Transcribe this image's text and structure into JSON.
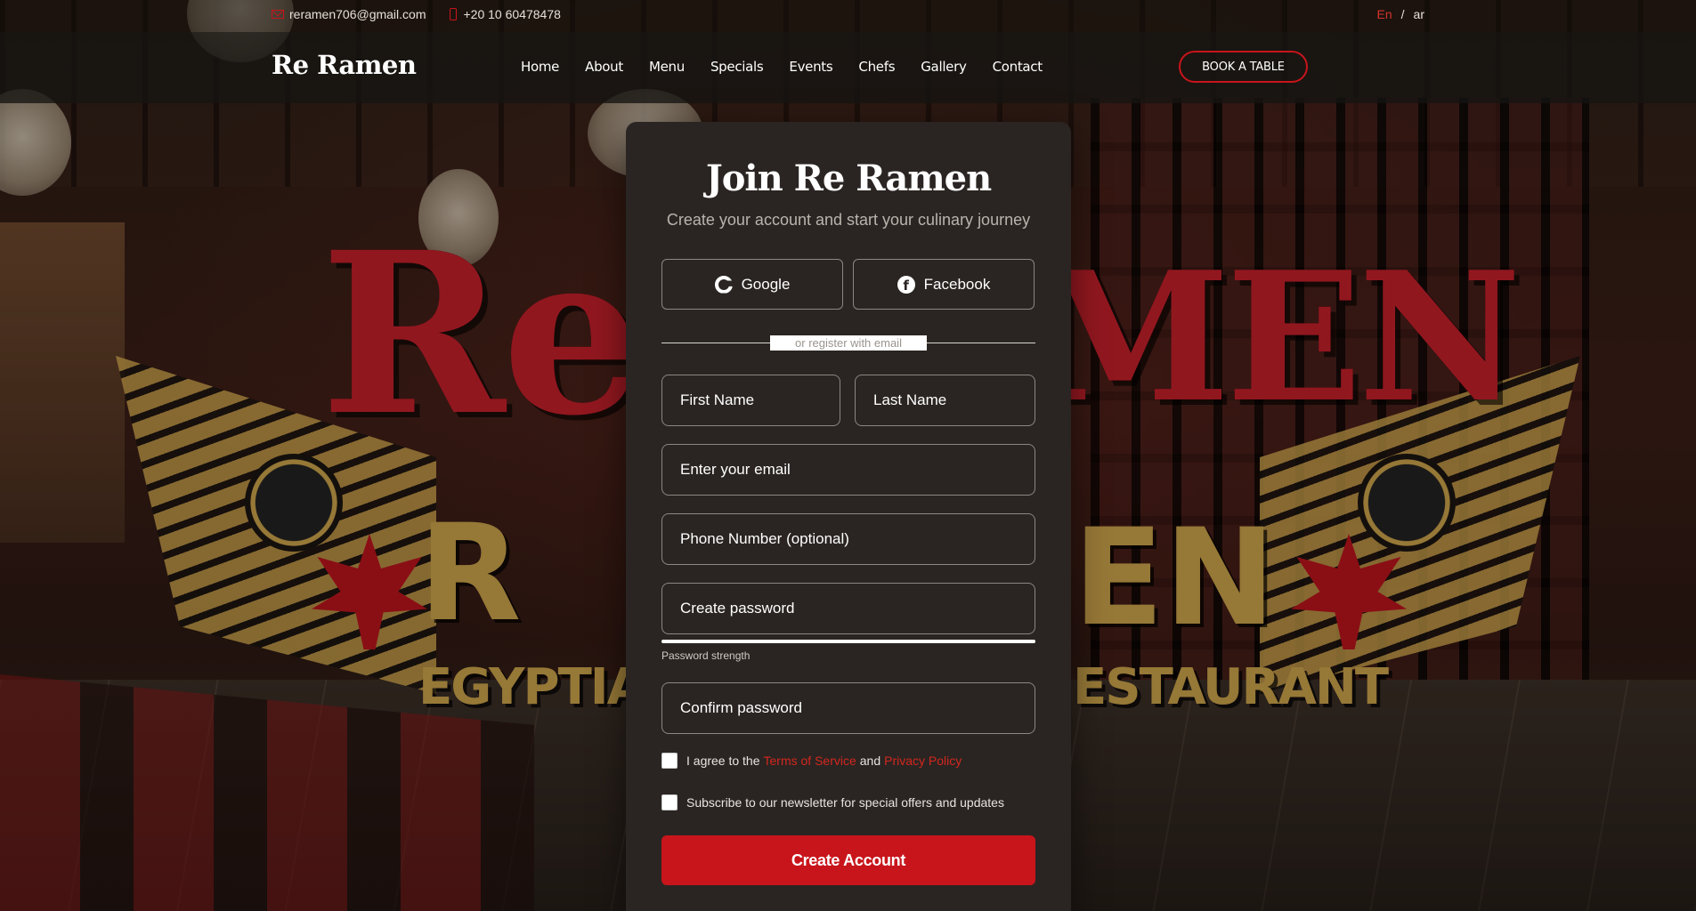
{
  "topbar": {
    "email": "reramen706@gmail.com",
    "phone": "+20 10 60478478",
    "lang_en": "En",
    "lang_separator": "/",
    "lang_ar": "ar"
  },
  "header": {
    "brand": "Re Ramen",
    "nav": [
      "Home",
      "About",
      "Menu",
      "Specials",
      "Events",
      "Chefs",
      "Gallery",
      "Contact"
    ],
    "book_button": "BOOK A TABLE"
  },
  "background": {
    "logo_word_1": "Re",
    "logo_word_2": "MEN",
    "logo_word_3": "R",
    "logo_word_4": "EN",
    "logo_bottom_left": "EGYPTIAN",
    "logo_bottom_right": "ESTAURANT"
  },
  "form": {
    "title": "Join Re Ramen",
    "subtitle": "Create your account and start your culinary journey",
    "google_label": "Google",
    "facebook_label": "Facebook",
    "divider_text": "or register with email",
    "first_name_placeholder": "First Name",
    "last_name_placeholder": "Last Name",
    "email_placeholder": "Enter your email",
    "phone_placeholder": "Phone Number (optional)",
    "password_placeholder": "Create password",
    "password_strength_label": "Password strength",
    "confirm_password_placeholder": "Confirm password",
    "agree_prefix": "I agree to the",
    "terms_link": "Terms of Service",
    "agree_and": "and",
    "privacy_link": "Privacy Policy",
    "newsletter_label": "Subscribe to our newsletter for special offers and updates",
    "create_button": "Create Account"
  },
  "colors": {
    "accent": "#c8151b",
    "card_bg": "#2a2522"
  }
}
